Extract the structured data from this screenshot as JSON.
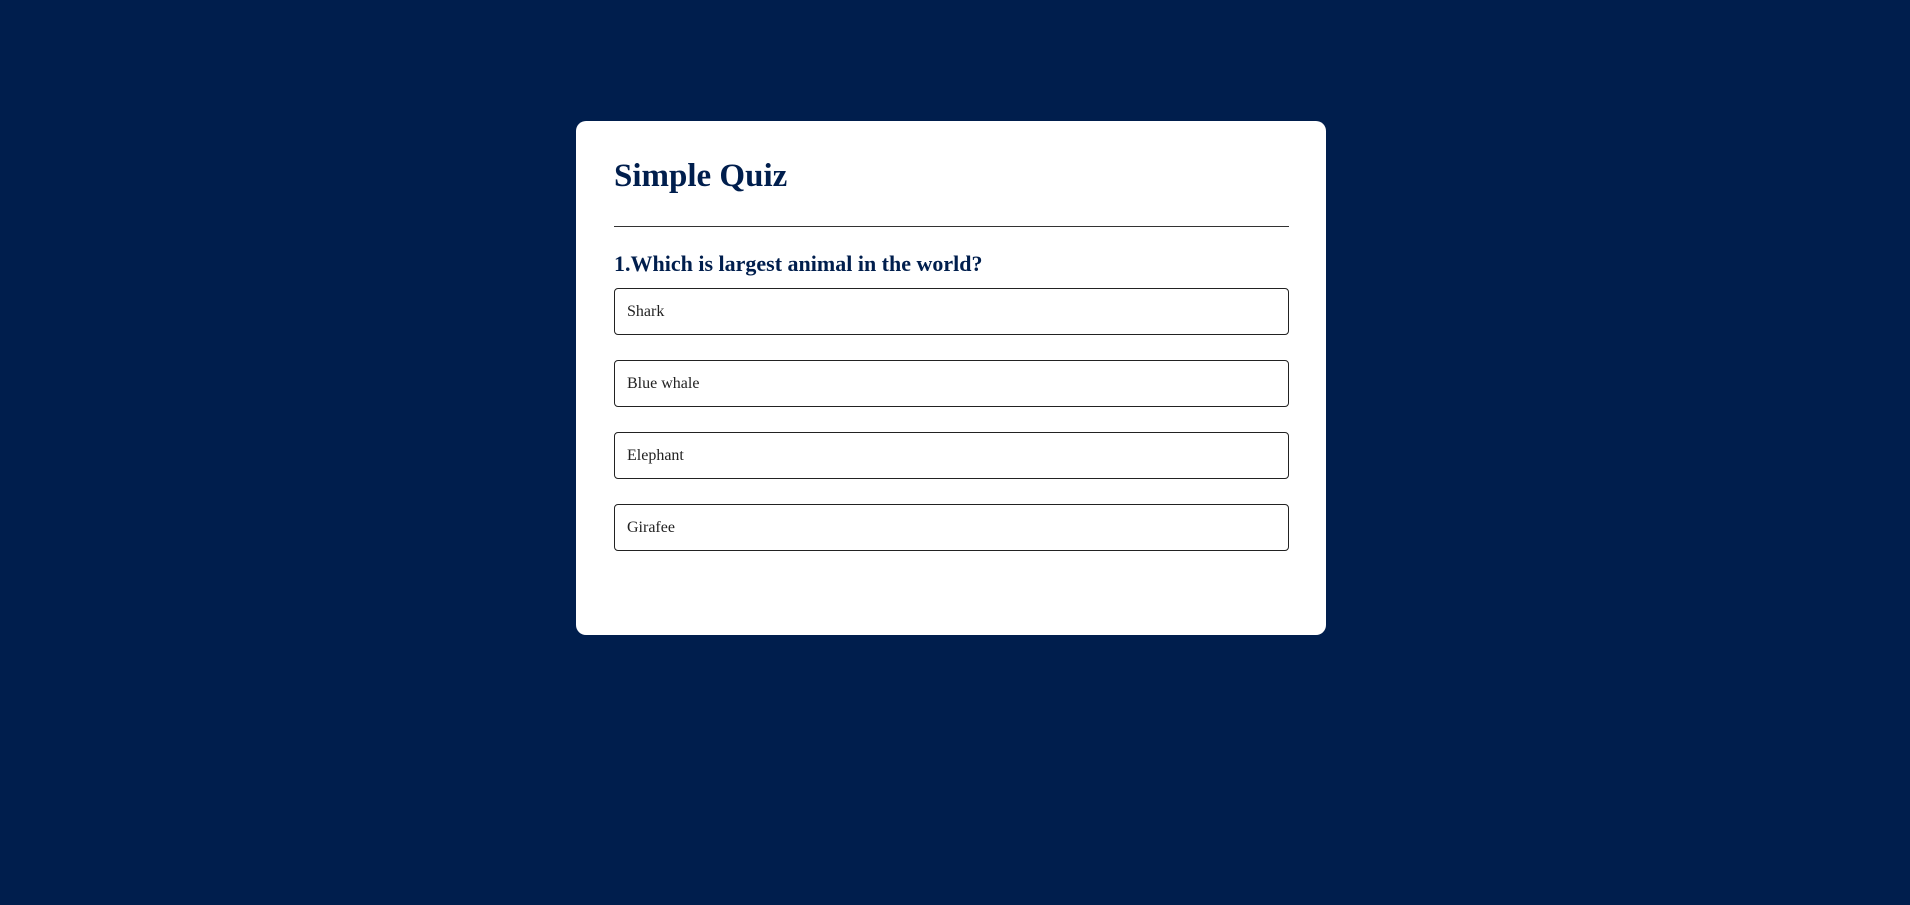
{
  "quiz": {
    "title": "Simple Quiz",
    "question": "1.Which is largest animal in the world?",
    "answers": [
      "Shark",
      "Blue whale",
      "Elephant",
      "Girafee"
    ]
  },
  "colors": {
    "background": "#001e4d",
    "card": "#ffffff",
    "heading_text": "#001e4d",
    "answer_border": "#222222"
  }
}
